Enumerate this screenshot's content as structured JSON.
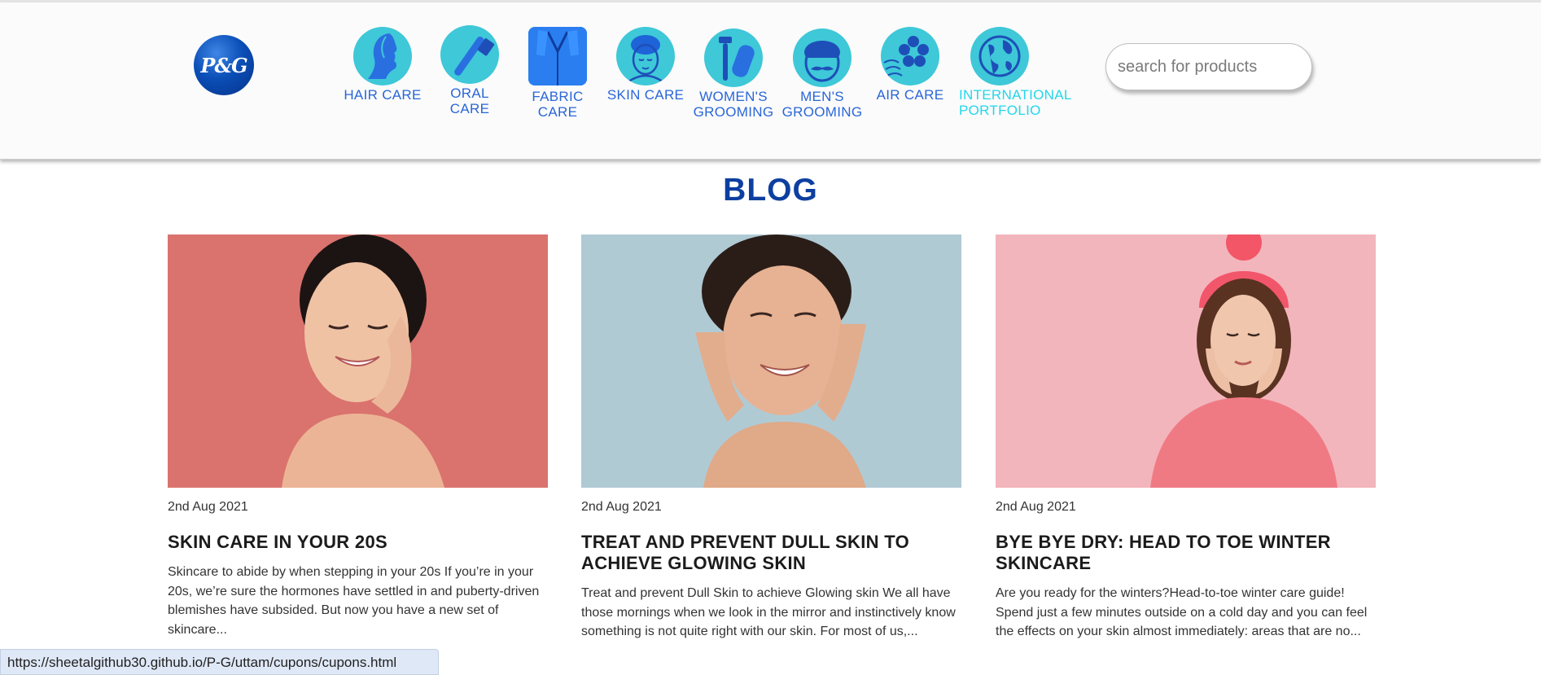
{
  "header": {
    "logo_text": "P&G",
    "nav": [
      {
        "label": "HAIR CARE",
        "icon": "hair-care-icon"
      },
      {
        "label": "ORAL CARE",
        "icon": "toothbrush-icon"
      },
      {
        "label": "FABRIC CARE",
        "icon": "shirt-icon"
      },
      {
        "label": "SKIN CARE",
        "icon": "face-care-icon"
      },
      {
        "label": "WOMEN'S GROOMING",
        "icon": "razor-icon"
      },
      {
        "label": "MEN'S GROOMING",
        "icon": "mustache-face-icon"
      },
      {
        "label": "AIR CARE",
        "icon": "flower-breeze-icon"
      },
      {
        "label": "INTERNATIONAL PORTFOLIO",
        "icon": "globe-icon"
      }
    ],
    "search": {
      "placeholder": "search for products",
      "value": ""
    }
  },
  "blog": {
    "title": "BLOG",
    "posts": [
      {
        "date": "2nd Aug 2021",
        "title": "SKIN CARE IN YOUR 20S",
        "excerpt": "Skincare to abide by when stepping in your 20s If you’re in your 20s, we’re sure the hormones have settled in and puberty-driven blemishes have subsided. But now you have a new set of skincare...",
        "image_bg": "#d97470"
      },
      {
        "date": "2nd Aug 2021",
        "title": "TREAT AND PREVENT DULL SKIN TO ACHIEVE GLOWING SKIN",
        "excerpt": "Treat and prevent Dull Skin to achieve Glowing skin We all have those mornings when we look in the mirror and instinctively know something is not quite right with our skin. For most of us,...",
        "image_bg": "#afc9d3"
      },
      {
        "date": "2nd Aug 2021",
        "title": "BYE BYE DRY: HEAD TO TOE WINTER SKINCARE",
        "excerpt": "Are you ready for the winters?Head-to-toe winter care guide! Spend just a few minutes outside on a cold day and you can feel the effects on your skin almost immediately: areas that are no...",
        "image_bg": "#f2b4bb"
      }
    ]
  },
  "status_bar": {
    "url": "https://sheetalgithub30.github.io/P-G/uttam/cupons/cupons.html"
  },
  "colors": {
    "accent_blue": "#0d3fa0",
    "nav_blue": "#2a66d8",
    "icon_teal": "#3ec8d8",
    "intl_cyan": "#22d7ea"
  }
}
